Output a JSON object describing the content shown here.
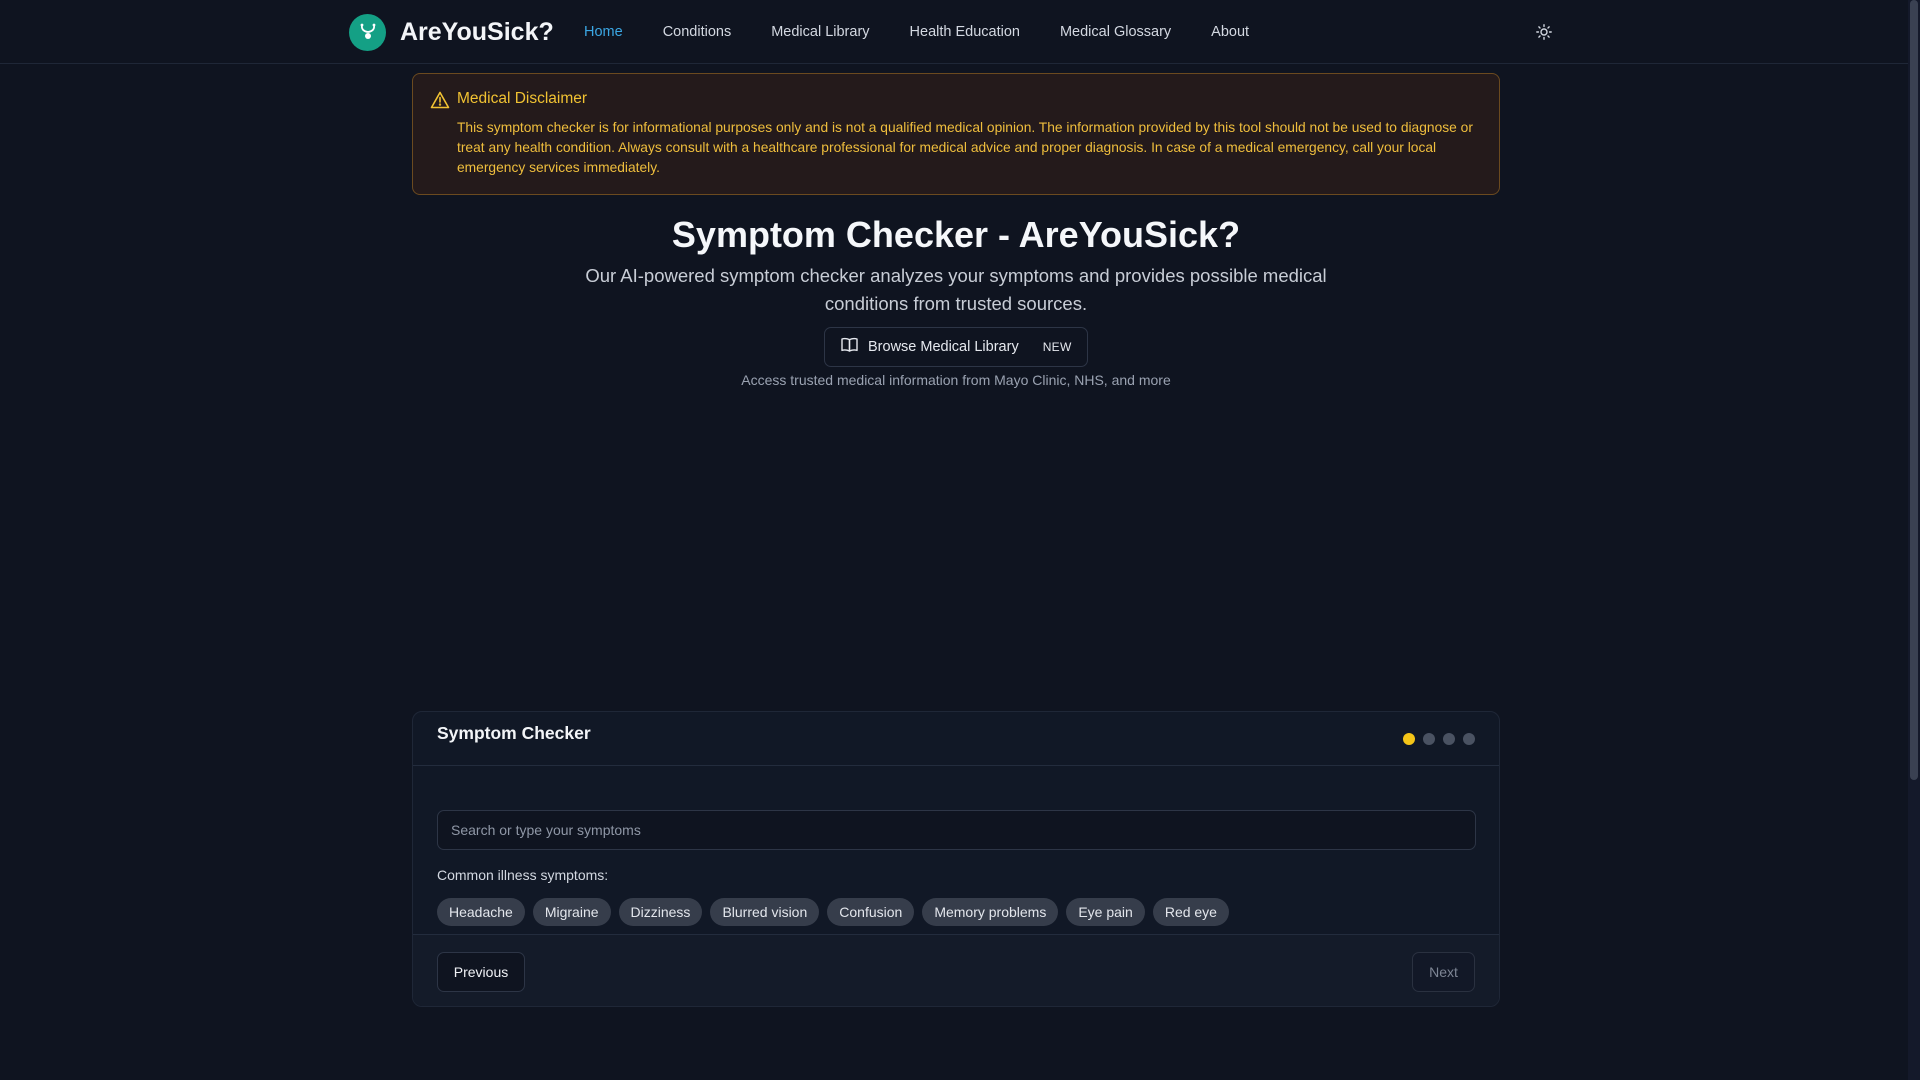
{
  "brand": {
    "name": "AreYouSick?",
    "logo_icon": "stethoscope-icon",
    "logo_color": "#14a085"
  },
  "nav": {
    "items": [
      {
        "label": "Home",
        "active": true
      },
      {
        "label": "Conditions",
        "active": false
      },
      {
        "label": "Medical Library",
        "active": false
      },
      {
        "label": "Health Education",
        "active": false
      },
      {
        "label": "Medical Glossary",
        "active": false
      },
      {
        "label": "About",
        "active": false
      }
    ],
    "theme_toggle_icon": "sun-icon",
    "active_color": "#3ba7e4"
  },
  "disclaimer": {
    "icon": "warning-triangle-icon",
    "title": "Medical Disclaimer",
    "text": "This symptom checker is for informational purposes only and is not a qualified medical opinion. The information provided by this tool should not be used to diagnose or treat any health condition. Always consult with a healthcare professional for medical advice and proper diagnosis. In case of a medical emergency, call your local emergency services immediately.",
    "color": "#efbe3d"
  },
  "hero": {
    "title": "Symptom Checker - AreYouSick?",
    "subtitle": "Our AI-powered symptom checker analyzes your symptoms and provides possible medical conditions from trusted sources.",
    "library_button": {
      "icon": "open-book-icon",
      "label": "Browse Medical Library",
      "badge": "NEW"
    },
    "note": "Access trusted medical information from Mayo Clinic, NHS, and more"
  },
  "checker": {
    "title": "Symptom Checker",
    "steps_total": 4,
    "current_step": 1,
    "step_active_color": "#f5c518",
    "search_placeholder": "Search or type your symptoms",
    "search_value": "",
    "common_label": "Common illness symptoms:",
    "chips": [
      "Headache",
      "Migraine",
      "Dizziness",
      "Blurred vision",
      "Confusion",
      "Memory problems",
      "Eye pain",
      "Red eye"
    ],
    "previous_label": "Previous",
    "next_label": "Next"
  }
}
